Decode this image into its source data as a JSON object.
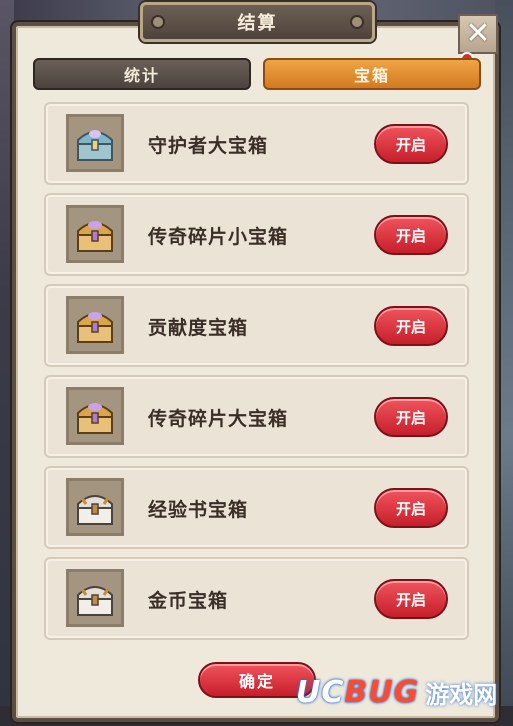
{
  "dialog": {
    "title": "结算",
    "close_label": "✕",
    "tabs": [
      {
        "label": "统计",
        "active": false
      },
      {
        "label": "宝箱",
        "active": true
      }
    ],
    "items": [
      {
        "name": "守护者大宝箱",
        "button": "开启",
        "icon": "guardian-chest-icon",
        "icon_color": "#7fb6c9"
      },
      {
        "name": "传奇碎片小宝箱",
        "button": "开启",
        "icon": "legend-chest-icon",
        "icon_color": "#d9a64a"
      },
      {
        "name": "贡献度宝箱",
        "button": "开启",
        "icon": "legend-chest-icon",
        "icon_color": "#d9a64a"
      },
      {
        "name": "传奇碎片大宝箱",
        "button": "开启",
        "icon": "legend-chest-icon",
        "icon_color": "#d9a64a"
      },
      {
        "name": "经验书宝箱",
        "button": "开启",
        "icon": "silver-chest-icon",
        "icon_color": "#e3e0da"
      },
      {
        "name": "金币宝箱",
        "button": "开启",
        "icon": "silver-chest-icon",
        "icon_color": "#e3e0da"
      }
    ],
    "confirm_label": "确定"
  },
  "watermark": {
    "en_main": "UC",
    "en_accent": "BUG",
    "cn": "游戏网"
  },
  "colors": {
    "panel_bg": "#efe9dc",
    "active_tab": "#e08f30",
    "button_red": "#d6303a",
    "notification_dot": "#e7262f"
  }
}
